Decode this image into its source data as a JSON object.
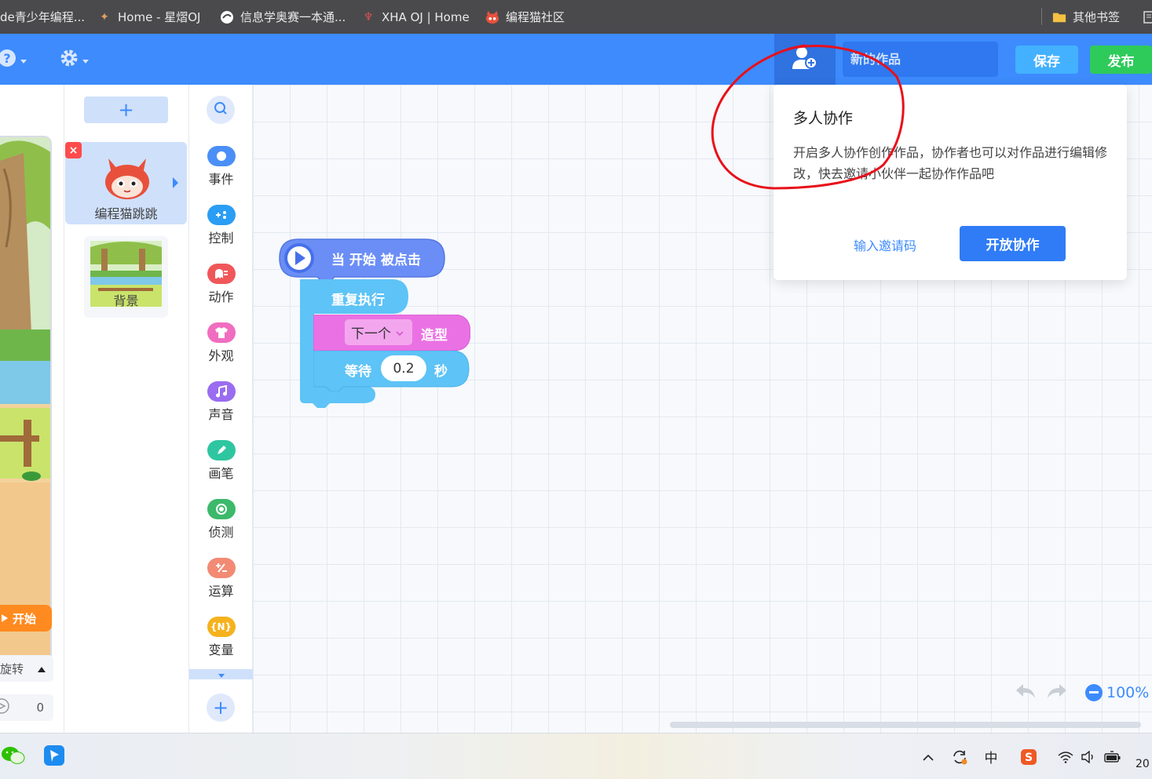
{
  "bookmarks": {
    "items": [
      {
        "label": "de青少年编程..."
      },
      {
        "label": "Home - 星熠OJ"
      },
      {
        "label": "信息学奥赛一本通..."
      },
      {
        "label": "XHA OJ | Home"
      },
      {
        "label": "编程猫社区"
      }
    ],
    "other_folder": "其他书签"
  },
  "header": {
    "title_placeholder": "新的作品",
    "save_label": "保存",
    "publish_label": "发布"
  },
  "stage": {
    "start_label": "开始",
    "rotate_label": "旋转",
    "value": "0"
  },
  "sprites": {
    "add_label": "+",
    "current": {
      "name": "编程猫跳跳"
    },
    "background": {
      "name": "背景"
    }
  },
  "categories": [
    {
      "label": "事件",
      "color": "#4a8ff7"
    },
    {
      "label": "控制",
      "color": "#2a9df4"
    },
    {
      "label": "动作",
      "color": "#f0575a"
    },
    {
      "label": "外观",
      "color": "#f06dbf"
    },
    {
      "label": "声音",
      "color": "#9a6cf0"
    },
    {
      "label": "画笔",
      "color": "#2ec6a0"
    },
    {
      "label": "侦测",
      "color": "#3cb96a"
    },
    {
      "label": "运算",
      "color": "#f28a74"
    },
    {
      "label": "变量",
      "color": "#f6b21d"
    }
  ],
  "variables_icon_text": "{N}",
  "add_category_label": "+",
  "blocks": {
    "event": {
      "label": "当 开始 被点击",
      "color": "#6b8ef6"
    },
    "repeat": {
      "label": "重复执行",
      "color": "#5ec3f6"
    },
    "looks": {
      "dropdown": "下一个",
      "suffix": "造型",
      "color": "#ea71e3"
    },
    "wait": {
      "prefix": "等待",
      "value": "0.2",
      "unit": "秒",
      "color": "#5ec3f6"
    }
  },
  "popup": {
    "title": "多人协作",
    "description": "开启多人协作创作作品，协作者也可以对作品进行编辑修改，快去邀请小伙伴一起协作作品吧",
    "invite_label": "输入邀请码",
    "open_label": "开放协作"
  },
  "zoom": {
    "level": "100%"
  },
  "taskbar": {
    "ime_label": "中",
    "clock": "20"
  },
  "colors": {
    "primary": "#3d8bfd",
    "header_dark": "#2f72e0",
    "save": "#43b1ff",
    "publish": "#2ecb5b",
    "annotation": "#e8101b"
  }
}
